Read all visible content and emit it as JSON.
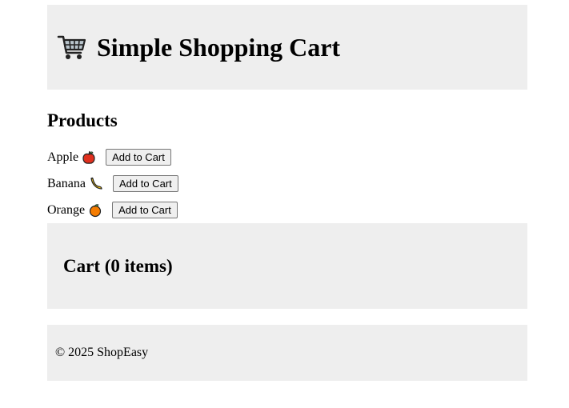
{
  "header": {
    "title": "Simple Shopping Cart",
    "icon": "shopping-cart-icon"
  },
  "products": {
    "heading": "Products",
    "items": [
      {
        "name": "Apple",
        "icon": "apple-icon",
        "button_label": "Add to Cart"
      },
      {
        "name": "Banana",
        "icon": "banana-icon",
        "button_label": "Add to Cart"
      },
      {
        "name": "Orange",
        "icon": "orange-icon",
        "button_label": "Add to Cart"
      }
    ]
  },
  "cart": {
    "heading": "Cart (0 items)"
  },
  "footer": {
    "text": "© 2025 ShopEasy"
  },
  "colors": {
    "panel_background": "#eeeeee",
    "page_background": "#ffffff"
  }
}
